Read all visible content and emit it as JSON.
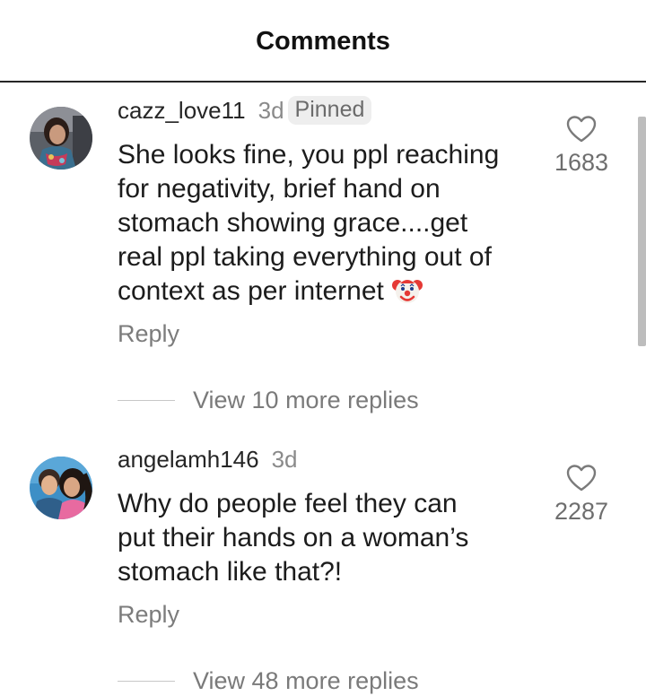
{
  "header": {
    "title": "Comments"
  },
  "comments": [
    {
      "username": "cazz_love11",
      "time": "3d",
      "pinned_label": "Pinned",
      "text_lines": [
        "She looks fine, you ppl reaching",
        "for negativity, brief hand on",
        "stomach showing grace....get",
        "real ppl taking everything out of",
        "context as per internet"
      ],
      "emoji": "clown-face-emoji",
      "reply_label": "Reply",
      "view_replies": "View 10 more replies",
      "likes": "1683",
      "avatar_icon": "profile-photo-avatar"
    },
    {
      "username": "angelamh146",
      "time": "3d",
      "text_lines": [
        "Why do people feel they can",
        "put their hands on a woman’s",
        "stomach like that?!"
      ],
      "reply_label": "Reply",
      "view_replies": "View 48 more replies",
      "likes": "2287",
      "avatar_icon": "profile-photo-avatar"
    }
  ],
  "icons": {
    "like": "heart-outline-icon"
  }
}
